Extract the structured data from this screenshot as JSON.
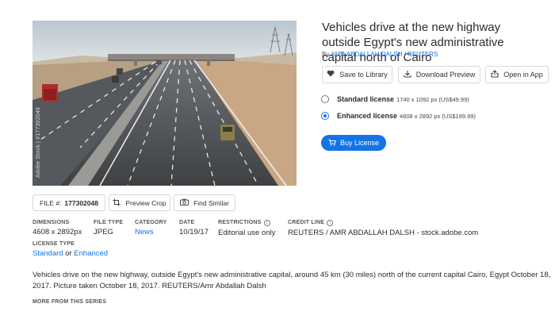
{
  "image": {
    "watermark": "Adobe Stock | #177302048"
  },
  "asset": {
    "title": "Vehicles drive at the new highway outside Egypt's new administrative capital north of Cairo",
    "by_prefix": "By",
    "author": "AMR ABDALLAH DALSH / REUTERS"
  },
  "actions": {
    "save": {
      "label": "Save to Library",
      "icon": "heart-icon"
    },
    "download": {
      "label": "Download Preview",
      "icon": "download-icon"
    },
    "open": {
      "label": "Open in App",
      "icon": "open-in-app-icon"
    }
  },
  "licenses": [
    {
      "name": "Standard license",
      "detail": "1740 x 1092 px (US$49.99)",
      "selected": false
    },
    {
      "name": "Enhanced license",
      "detail": "4608 x 2892 px (US$199.99)",
      "selected": true
    }
  ],
  "buy": {
    "label": "Buy License",
    "icon": "cart-icon"
  },
  "file_number": {
    "label": "FILE #:",
    "value": "177302048"
  },
  "preview_crop": {
    "label": "Preview Crop",
    "icon": "crop-icon"
  },
  "find_similar": {
    "label": "Find Similar",
    "icon": "camera-icon"
  },
  "meta": {
    "dimensions": {
      "label": "DIMENSIONS",
      "value": "4608 x 2892px"
    },
    "file_type": {
      "label": "FILE TYPE",
      "value": "JPEG"
    },
    "category": {
      "label": "CATEGORY",
      "value": "News"
    },
    "date": {
      "label": "DATE",
      "value": "10/19/17"
    },
    "restrictions": {
      "label": "RESTRICTIONS",
      "value": "Editorial use only"
    },
    "credit": {
      "label": "CREDIT LINE",
      "value": "REUTERS / AMR ABDALLAH DALSH - stock.adobe.com"
    },
    "license_type": {
      "label": "LICENSE TYPE",
      "standard": "Standard",
      "or": "or",
      "enhanced": "Enhanced"
    }
  },
  "description": "Vehicles drive on the new highway, outside Egypt's new administrative capital, around 45 km (30 miles) north of the current capital Cairo, Egypt October 18, 2017. Picture taken October 18, 2017. REUTERS/Amr Abdallah Dalsh",
  "more_series": "MORE FROM THIS SERIES",
  "colors": {
    "accent": "#1473e6",
    "text": "#2c2c2c",
    "border": "#d8d8d8"
  }
}
